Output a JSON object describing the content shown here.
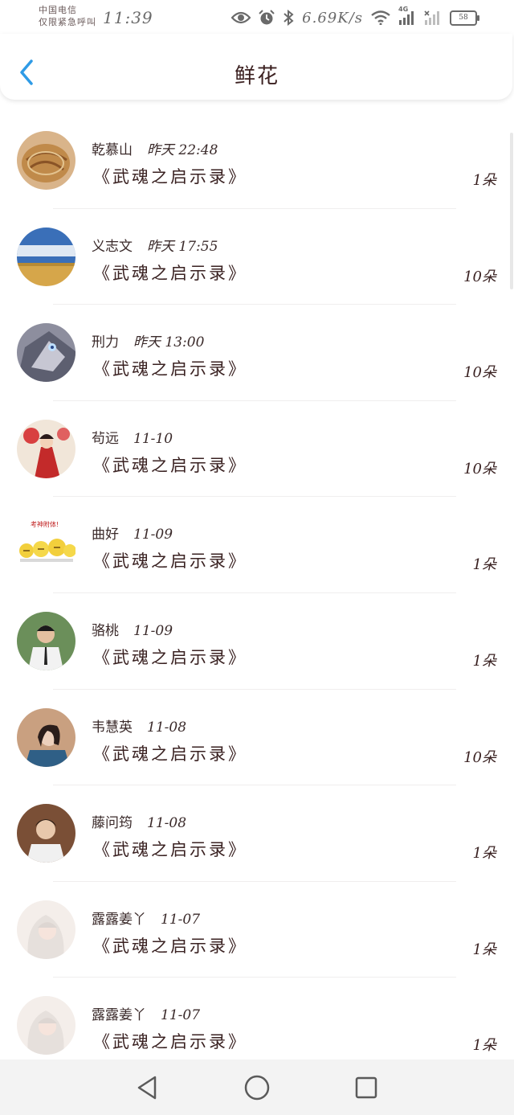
{
  "status_bar": {
    "carrier_line1": "中国电信",
    "carrier_line2": "仅限紧急呼叫",
    "time": "11:39",
    "net_speed": "6.69K/s",
    "signal_label": "4G",
    "battery": "58",
    "icons": [
      "eye-icon",
      "alarm-icon",
      "bluetooth-icon",
      "wifi-icon",
      "signal-icon",
      "no-signal-icon",
      "battery-icon"
    ]
  },
  "header": {
    "title": "鲜花",
    "back_icon": "chevron-left-icon",
    "accent_color": "#2f9be6"
  },
  "list": [
    {
      "name": "乾慕山",
      "time": "昨天 22:48",
      "book": "《武魂之启示录》",
      "count": "1朵",
      "avatar": "food-avatar"
    },
    {
      "name": "义志文",
      "time": "昨天 17:55",
      "book": "《武魂之启示录》",
      "count": "10朵",
      "avatar": "landscape-avatar"
    },
    {
      "name": "刑力",
      "time": "昨天 13:00",
      "book": "《武魂之启示录》",
      "count": "10朵",
      "avatar": "wolf-avatar"
    },
    {
      "name": "茍远",
      "time": "11-10",
      "book": "《武魂之启示录》",
      "count": "10朵",
      "avatar": "costume-avatar"
    },
    {
      "name": "曲好",
      "time": "11-09",
      "book": "《武魂之启示录》",
      "count": "1朵",
      "avatar": "emoji-avatar",
      "avatar_text": "考神附体!"
    },
    {
      "name": "骆桃",
      "time": "11-09",
      "book": "《武魂之启示录》",
      "count": "1朵",
      "avatar": "boy-avatar"
    },
    {
      "name": "韦慧英",
      "time": "11-08",
      "book": "《武魂之启示录》",
      "count": "10朵",
      "avatar": "girl-avatar"
    },
    {
      "name": "藤问筠",
      "time": "11-08",
      "book": "《武魂之启示录》",
      "count": "1朵",
      "avatar": "man-avatar"
    },
    {
      "name": "露露姜丫",
      "time": "11-07",
      "book": "《武魂之启示录》",
      "count": "1朵",
      "avatar": "white-hair-avatar"
    },
    {
      "name": "露露姜丫",
      "time": "11-07",
      "book": "《武魂之启示录》",
      "count": "1朵",
      "avatar": "white-hair-avatar"
    }
  ],
  "nav_bar": {
    "buttons": [
      "back-triangle-icon",
      "home-circle-icon",
      "recents-square-icon"
    ]
  }
}
